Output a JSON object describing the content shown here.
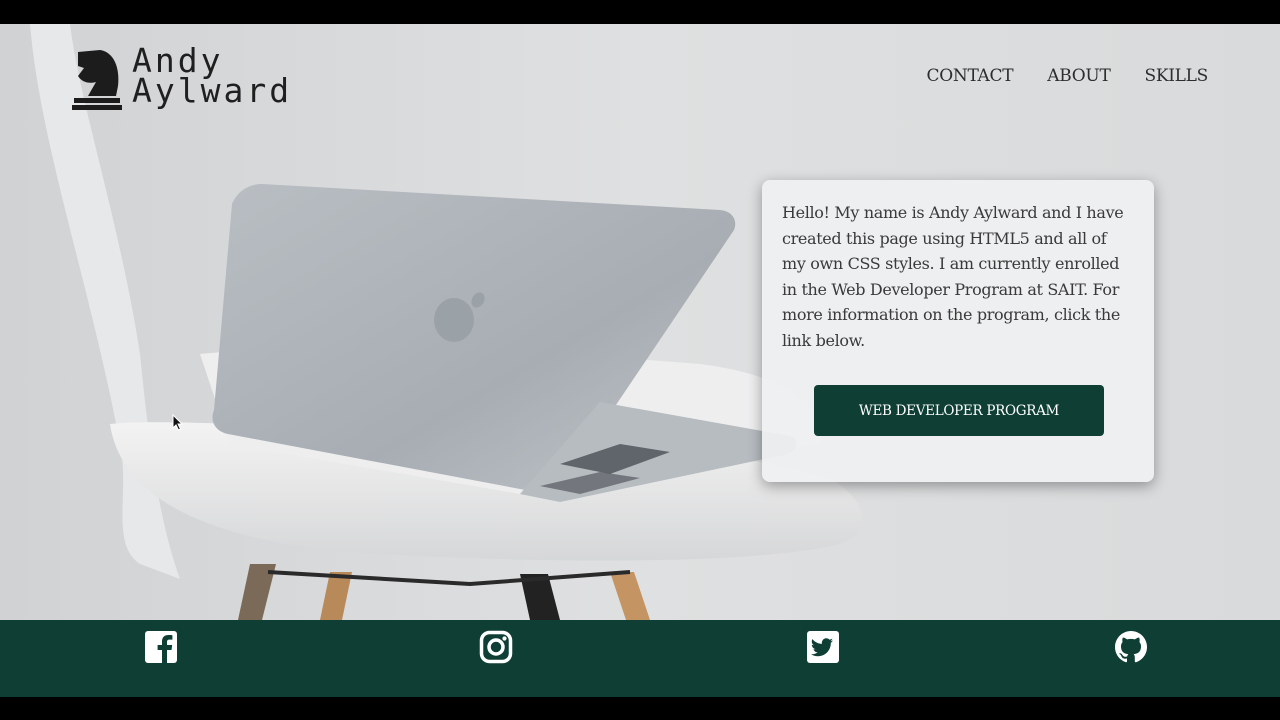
{
  "brand": {
    "name_line1": "Andy",
    "name_line2": "Aylward",
    "logo_icon": "chess-knight-icon"
  },
  "nav": {
    "items": [
      {
        "label": "CONTACT"
      },
      {
        "label": "ABOUT"
      },
      {
        "label": "SKILLS"
      }
    ]
  },
  "intro": {
    "text": "Hello! My name is Andy Aylward and I have created this page using HTML5 and all of my own CSS styles. I am currently enrolled in the Web Developer Program at SAIT. For more information on the program, click the link below.",
    "button_label": "WEB DEVELOPER PROGRAM"
  },
  "footer": {
    "social": [
      {
        "icon": "facebook-icon"
      },
      {
        "icon": "instagram-icon"
      },
      {
        "icon": "twitter-icon"
      },
      {
        "icon": "github-icon"
      }
    ]
  },
  "colors": {
    "accent": "#0f3f34",
    "text": "#3a3a3a",
    "card_bg": "#eef0f1"
  }
}
